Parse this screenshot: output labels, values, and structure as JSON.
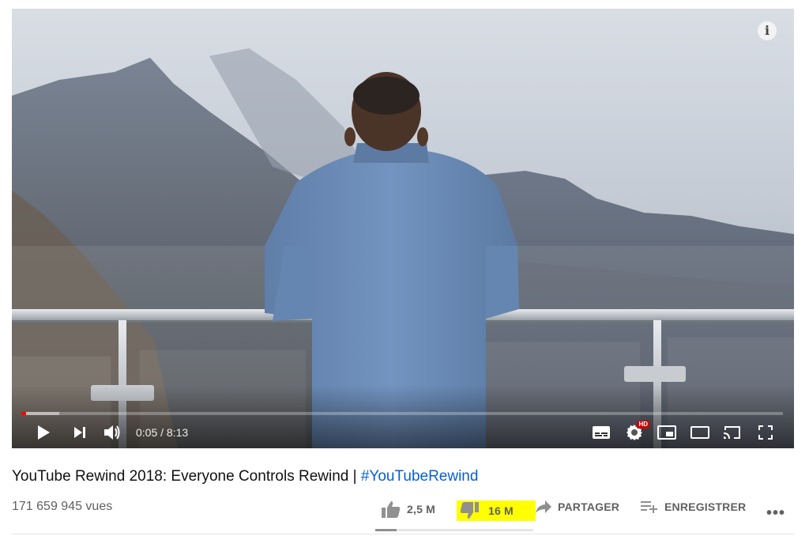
{
  "player": {
    "current_time": "0:05",
    "duration": "8:13",
    "time_display": "0:05 / 8:13",
    "progress_fraction": 0.006,
    "buffered_fraction": 0.05,
    "hd_badge": "HD",
    "info_glyph": "i",
    "icons": [
      "info-icon",
      "play-icon",
      "next-icon",
      "volume-icon",
      "subtitles-icon",
      "settings-icon",
      "miniplayer-icon",
      "theater-mode-icon",
      "cast-icon",
      "fullscreen-icon"
    ],
    "colors": {
      "progress_played": "#ff0000",
      "hd_badge": "#cc0000"
    }
  },
  "video": {
    "title_main": "YouTube Rewind 2018: Everyone Controls Rewind | ",
    "title_hashtag": "#YouTubeRewind",
    "views": "171 659 945 vues",
    "likes": "2,5 M",
    "dislikes": "16 M",
    "like_ratio": 0.135,
    "share_label": "PARTAGER",
    "save_label": "ENREGISTRER",
    "more_glyph": "•••",
    "colors": {
      "hashtag": "#065fd4",
      "dislike_highlight": "#ffff00"
    }
  }
}
